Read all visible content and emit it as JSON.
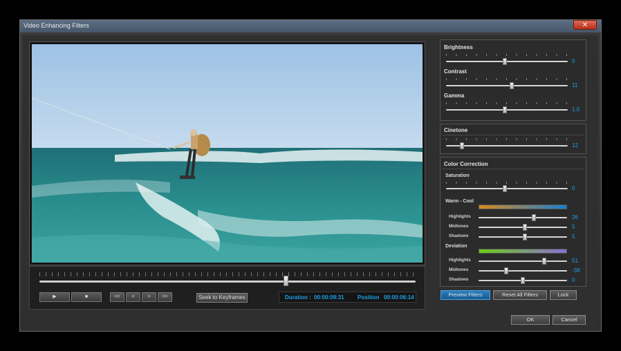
{
  "window": {
    "title": "Video Enhancing Filters",
    "close_label": "✕"
  },
  "transport": {
    "play_label": "▶",
    "stop_label": "■",
    "rewind_label": "<<",
    "prev_label": "<",
    "next_label": ">",
    "forward_label": ">>",
    "seek_keyframes_label": "Seek to Keyframes",
    "duration_label": "Duration :",
    "duration_value": "00:00:09:31",
    "position_label": "Position",
    "position_value": "00:00:06:14",
    "seek_fraction": 0.655
  },
  "basic": {
    "brightness": {
      "label": "Brightness",
      "value": "0"
    },
    "contrast": {
      "label": "Contrast",
      "value": "11"
    },
    "gamma": {
      "label": "Gamma",
      "value": "1.0"
    }
  },
  "cinetone": {
    "title": "Cinetone",
    "value": "12"
  },
  "color_correction": {
    "title": "Color Correction",
    "saturation": {
      "label": "Saturation",
      "value": "0"
    },
    "warm_cool": {
      "label": "Warm - Cool",
      "gradient": [
        "#d88a1e",
        "#1a7fd0"
      ],
      "highlights": {
        "label": "Highlights",
        "value": "26"
      },
      "midtones": {
        "label": "Midtones",
        "value": "5"
      },
      "shadows": {
        "label": "Shadows",
        "value": "5"
      }
    },
    "deviation": {
      "label": "Deviation",
      "gradient": [
        "#6bcc17",
        "#8a6fd6"
      ],
      "highlights": {
        "label": "Highlights",
        "value": "51"
      },
      "midtones": {
        "label": "Midtones",
        "value": "-38"
      },
      "shadows": {
        "label": "Shadows",
        "value": "0"
      }
    }
  },
  "buttons": {
    "preview_filters": "Preview Filters",
    "reset_all_filters": "Reset All Filters",
    "lock": "Lock",
    "ok": "OK",
    "cancel": "Cancel"
  },
  "colors": {
    "accent": "#1da1e6",
    "sky": "#a9c8e6",
    "sea": "#2f8a8c"
  }
}
